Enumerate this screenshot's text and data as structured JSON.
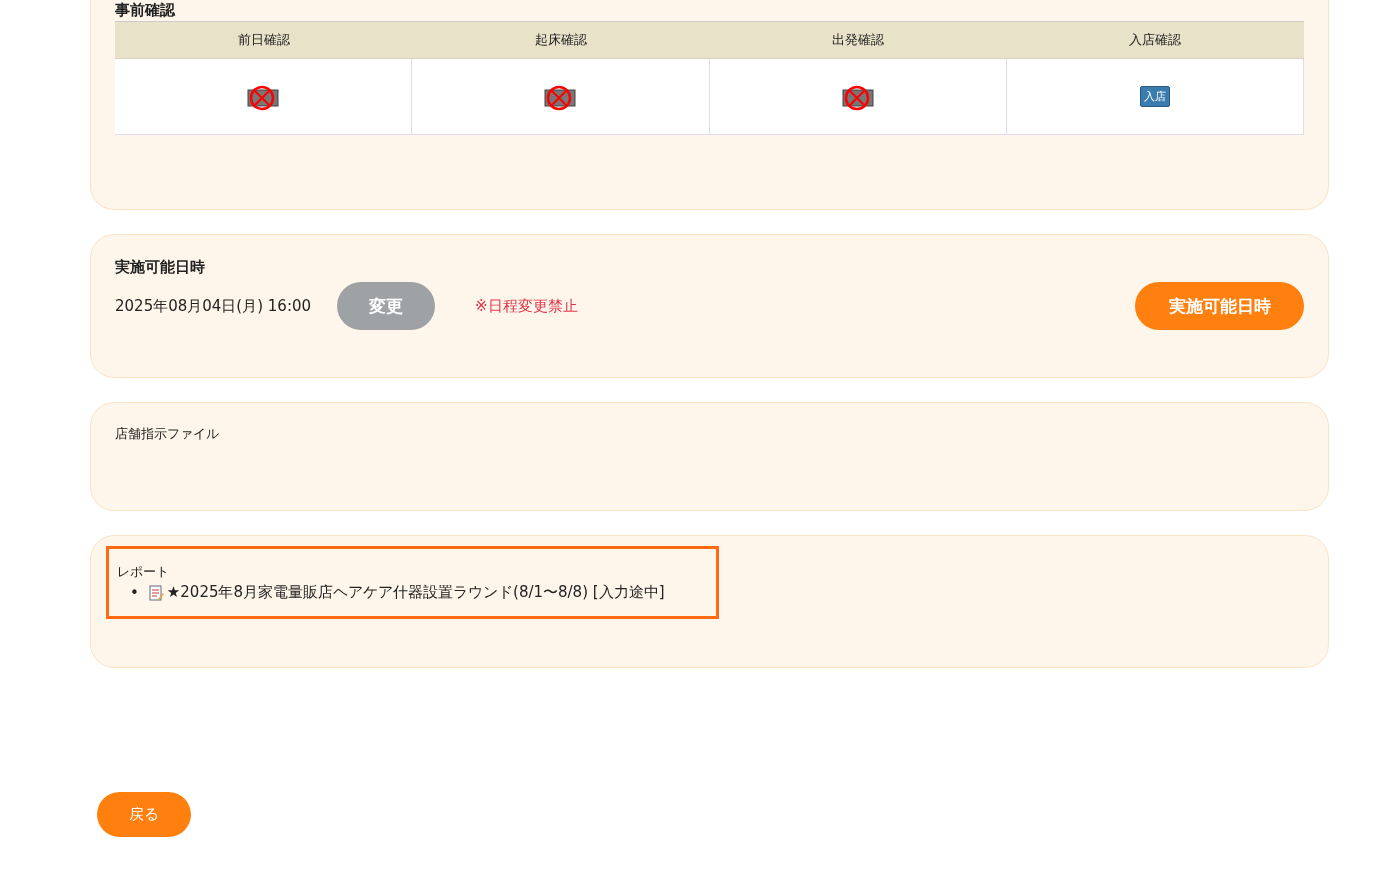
{
  "precheck": {
    "title": "事前確認",
    "columns": [
      {
        "label": "前日確認",
        "kind": "crossed"
      },
      {
        "label": "起床確認",
        "kind": "crossed"
      },
      {
        "label": "出発確認",
        "kind": "crossed"
      },
      {
        "label": "入店確認",
        "kind": "badge",
        "badge": "入店"
      }
    ]
  },
  "schedule": {
    "title": "実施可能日時",
    "datetime": "2025年08月04日(月) 16:00",
    "change_button": {
      "label": "変更",
      "disabled": true
    },
    "notice": "※日程変更禁止",
    "action_button": "実施可能日時"
  },
  "store_files": {
    "title": "店舗指示ファイル"
  },
  "report": {
    "title": "レポート",
    "highlighted": true,
    "bullet": "•",
    "items": [
      "★2025年8月家電量販店ヘアケア什器設置ラウンド(8/1〜8/8) [入力途中]"
    ]
  },
  "back_button": "戻る"
}
